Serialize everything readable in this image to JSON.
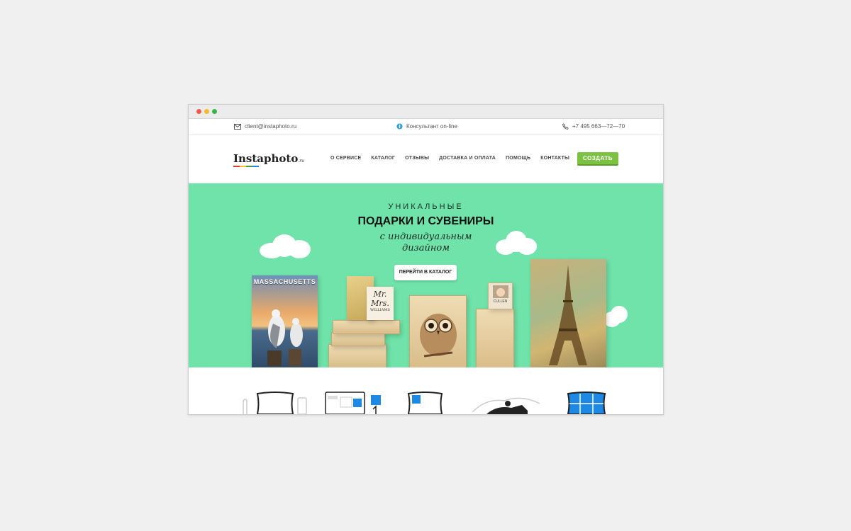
{
  "window": {
    "dots": [
      "#f15a4a",
      "#f5b82e",
      "#39b54a"
    ]
  },
  "topbar": {
    "email": "client@instaphoto.ru",
    "consultant": "Консультант on-line",
    "phone": "+7 495 663—72—70"
  },
  "header": {
    "logo": "Instaphoto",
    "logo_suffix": ".ru",
    "menu": [
      "О СЕРВИСЕ",
      "КАТАЛОГ",
      "ОТЗЫВЫ",
      "ДОСТАВКА И ОПЛАТА",
      "ПОМОЩЬ",
      "КОНТАКТЫ"
    ],
    "create_button": "СОЗДАТЬ"
  },
  "hero": {
    "line1": "УНИКАЛЬНЫЕ",
    "line2": "ПОДАРКИ И СУВЕНИРЫ",
    "line3": "с индивидуальным",
    "line4": "дизайном",
    "cta": "ПЕРЕЙТИ В КАТАЛОГ",
    "background": "#6fe3a9",
    "products": {
      "poster_title": "MASSACHUSETTS",
      "box_text1": "Mr.",
      "box_text2": "Mrs.",
      "box_text3": "WILLIAMS",
      "block_text": "CULLEN"
    }
  },
  "colors": {
    "accent_green": "#7cc242",
    "accent_blue": "#1e88e5"
  }
}
